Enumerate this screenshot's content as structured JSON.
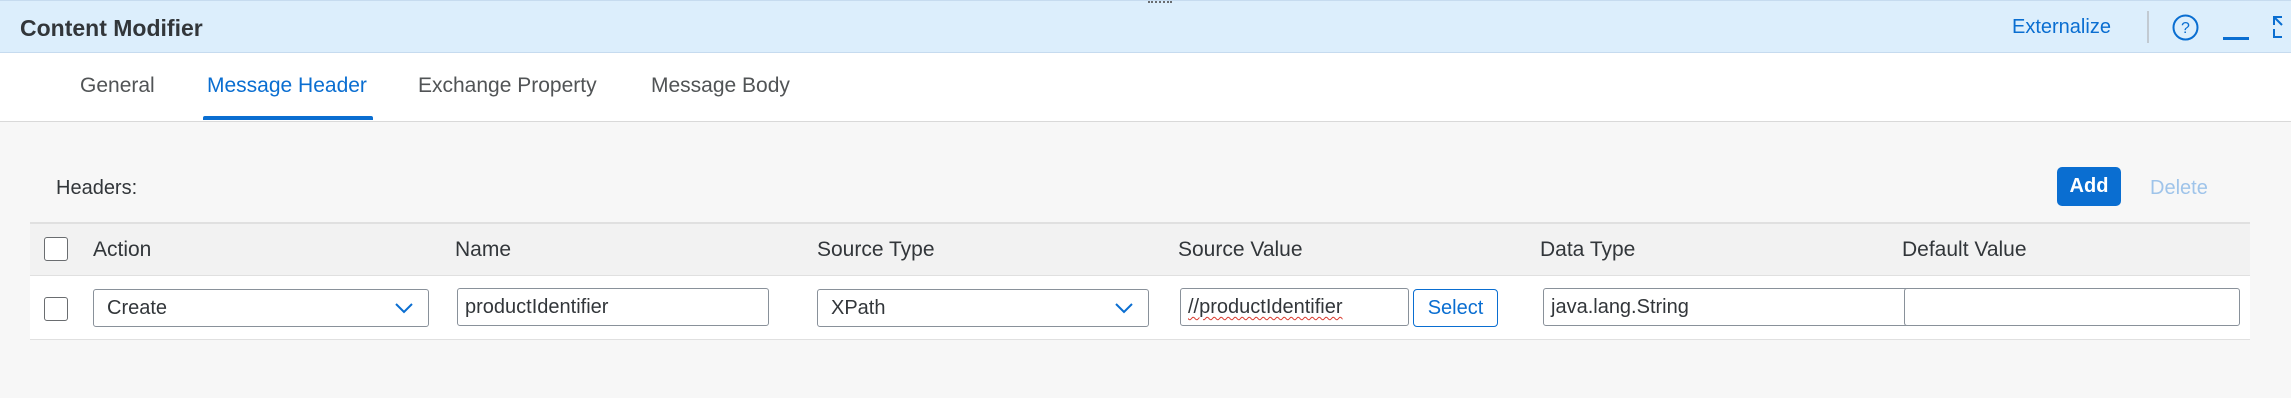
{
  "titlebar": {
    "title": "Content Modifier",
    "externalize_label": "Externalize"
  },
  "icons": {
    "help": "help-circle-icon",
    "minimize": "minimize-icon",
    "expand": "expand-icon",
    "chevron": "chevron-down-icon"
  },
  "colors": {
    "accent": "#0a6ed1",
    "titlebar_bg": "#dceefc"
  },
  "tabs": [
    {
      "label": "General",
      "active": false
    },
    {
      "label": "Message Header",
      "active": true
    },
    {
      "label": "Exchange Property",
      "active": false
    },
    {
      "label": "Message Body",
      "active": false
    }
  ],
  "headers_section": {
    "label": "Headers:",
    "add_label": "Add",
    "delete_label": "Delete"
  },
  "table": {
    "columns": [
      "Action",
      "Name",
      "Source Type",
      "Source Value",
      "Data Type",
      "Default Value"
    ],
    "rows": [
      {
        "action": "Create",
        "name": "productIdentifier",
        "source_type": "XPath",
        "source_value": "//productIdentifier",
        "select_label": "Select",
        "data_type": "java.lang.String",
        "default_value": ""
      }
    ]
  }
}
